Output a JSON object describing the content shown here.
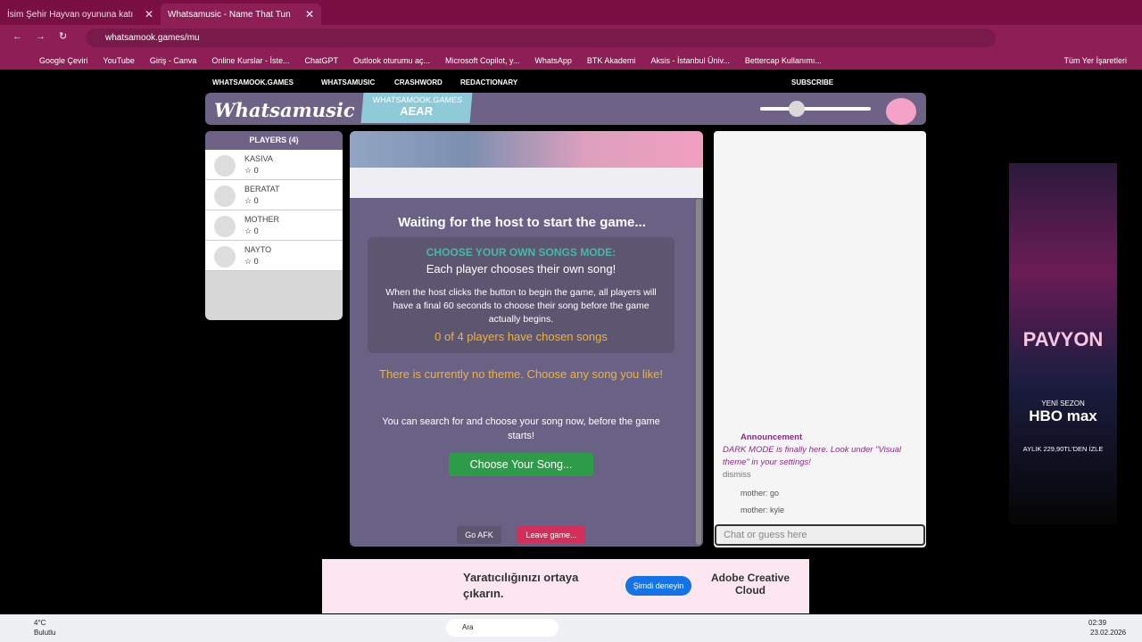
{
  "browser": {
    "tabs": [
      {
        "label": "İsim Şehir Hayvan oyununa katı"
      },
      {
        "label": "Whatsamusic - Name That Tun"
      }
    ],
    "url": "whatsamook.games/mu",
    "bookmarks": [
      "Google Çeviri",
      "YouTube",
      "Giriş - Canva",
      "Online Kurslar - İste...",
      "ChatGPT",
      "Outlook oturumu aç...",
      "Microsoft Copilot, y...",
      "WhatsApp",
      "BTK Akademi",
      "Aksis - İstanbul Üniv...",
      "Bettercap Kullanımı...",
      "Tüm Yer İşaretleri"
    ]
  },
  "site_nav": {
    "home": "WHATSAMOOK.GAMES",
    "music": "WHATSAMUSIC",
    "crash": "CRASHWORD",
    "redact": "REDACTIONARY",
    "subscribe": "SUBSCRIBE"
  },
  "header": {
    "logo": "Whatsamusic",
    "badge_top": "WHATSAMOOK.GAMES",
    "badge_code": "AEAR"
  },
  "players": {
    "title": "PLAYERS (4)",
    "list": [
      {
        "name": "KASIVA",
        "score": "0"
      },
      {
        "name": "BERATAT",
        "score": "0"
      },
      {
        "name": "MOTHER",
        "score": "0"
      },
      {
        "name": "NAYTO",
        "score": "0"
      }
    ]
  },
  "game": {
    "waiting": "Waiting for the host to start the game...",
    "mode_title": "CHOOSE YOUR OWN SONGS MODE:",
    "mode_sub": "Each player chooses their own song!",
    "mode_body": "When the host clicks the button to begin the game, all players will have a final 60 seconds to choose their song before the game actually begins.",
    "mode_count": "0 of 4 players have chosen songs",
    "theme": "There is currently no theme. Choose any song you like!",
    "search": "You can search for and choose your song now, before the game starts!",
    "choose_btn": "Choose Your Song...",
    "afk_btn": "Go AFK",
    "leave_btn": "Leave game..."
  },
  "chat": {
    "ann_title": "Announcement",
    "ann_text": "DARK MODE is finally here. Look under \"Visual theme\" in your settings!",
    "dismiss": "dismiss",
    "messages": [
      "mother: go",
      "mother: kyle"
    ],
    "placeholder": "Chat or guess here"
  },
  "ads": {
    "right_title": "PAVYON",
    "right_season": "YENİ SEZON",
    "right_brand": "HBO max",
    "right_price": "AYLIK 229,90TL'DEN İZLE",
    "bottom_text": "Yaratıcılığınızı ortaya çıkarın.",
    "bottom_btn": "Şimdi deneyin",
    "bottom_brand": "Adobe Creative Cloud"
  },
  "taskbar": {
    "weather": "4°C",
    "weather_sub": "Bulutlu",
    "search": "Ara",
    "time": "02:39",
    "date": "23.02.2026"
  }
}
